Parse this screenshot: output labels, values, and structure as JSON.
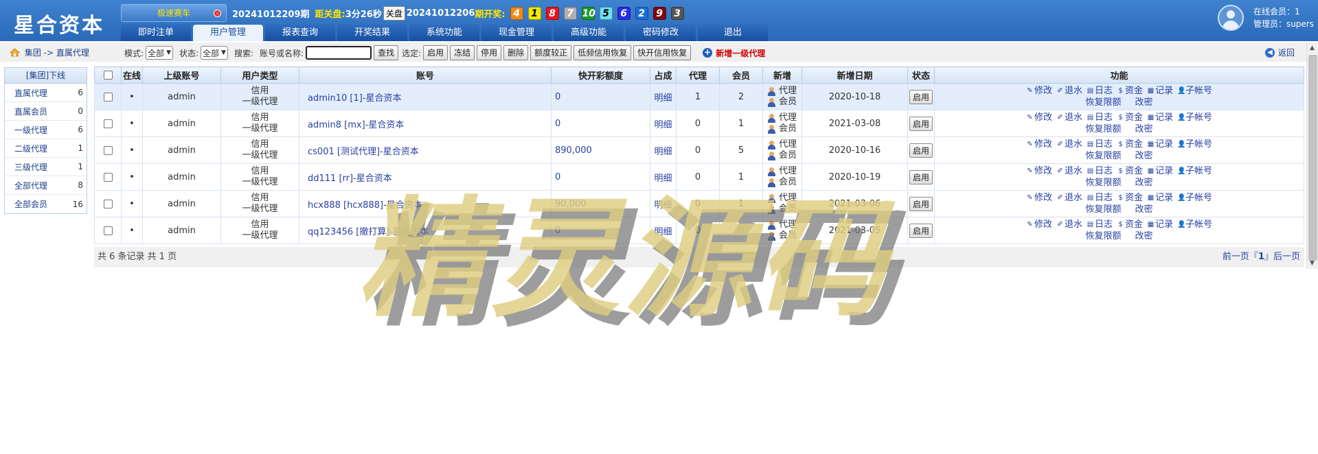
{
  "header": {
    "logo": "星合资本",
    "game_name": "极速赛车",
    "current_issue": "20241012209期",
    "close_label": "距关盘:",
    "countdown": "3分26秒",
    "close_button": "关盘",
    "last_issue": "20241012206",
    "last_draw_label": "期开奖:",
    "draw_balls": [
      {
        "n": "4",
        "bg": "#f08a16",
        "fg": "#ffffff"
      },
      {
        "n": "1",
        "bg": "#f2e700",
        "fg": "#000000"
      },
      {
        "n": "8",
        "bg": "#e8151b",
        "fg": "#ffffff"
      },
      {
        "n": "7",
        "bg": "#b0b0b0",
        "fg": "#ffffff"
      },
      {
        "n": "10",
        "bg": "#1a9a2c",
        "fg": "#ffffff"
      },
      {
        "n": "5",
        "bg": "#6ee0f0",
        "fg": "#000000"
      },
      {
        "n": "6",
        "bg": "#2a2ae8",
        "fg": "#ffffff"
      },
      {
        "n": "2",
        "bg": "#1a6ed8",
        "fg": "#ffffff"
      },
      {
        "n": "9",
        "bg": "#7a0c12",
        "fg": "#ffffff"
      },
      {
        "n": "3",
        "bg": "#555555",
        "fg": "#ffffff"
      }
    ],
    "nav": [
      "即时注单",
      "用户管理",
      "报表查询",
      "开奖结果",
      "系统功能",
      "现金管理",
      "高级功能",
      "密码修改",
      "退出"
    ],
    "active_nav": 1,
    "online_label": "在线会员：1",
    "admin_label": "管理员：supers"
  },
  "toolbar": {
    "crumb": "集团 -> 直属代理",
    "mode_label": "模式:",
    "mode_value": "全部",
    "status_label": "状态:",
    "status_value": "全部",
    "search_label": "搜索:",
    "search_hint": "账号或名称:",
    "search_value": "",
    "find_button": "查找",
    "selected_label": "选定:",
    "action_buttons": [
      "启用",
      "冻结",
      "停用",
      "删除",
      "额度较正",
      "低频信用恢复",
      "快开信用恢复"
    ],
    "add_agent": "新增一级代理",
    "back": "返回"
  },
  "sidebar": {
    "title": "[集团]下线",
    "items": [
      {
        "label": "直属代理",
        "count": "6"
      },
      {
        "label": "直属会员",
        "count": "0"
      },
      {
        "label": "一级代理",
        "count": "6"
      },
      {
        "label": "二级代理",
        "count": "1"
      },
      {
        "label": "三级代理",
        "count": "1"
      },
      {
        "label": "全部代理",
        "count": "8"
      },
      {
        "label": "全部会员",
        "count": "16"
      }
    ]
  },
  "table": {
    "headers": [
      "在线",
      "上级账号",
      "用户类型",
      "账号",
      "快开彩额度",
      "占成",
      "代理",
      "会员",
      "新增",
      "新增日期",
      "状态",
      "功能"
    ],
    "rows": [
      {
        "online": "•",
        "parent": "admin",
        "type1": "信用",
        "type2": "一级代理",
        "account": "admin10 [1]-星合资本",
        "credit": "0",
        "share": "明细",
        "agents": "1",
        "members": "2",
        "new_agent": "代理",
        "new_member": "会员",
        "date": "2020-10-18",
        "status": "启用"
      },
      {
        "online": "•",
        "parent": "admin",
        "type1": "信用",
        "type2": "一级代理",
        "account": "admin8 [mx]-星合资本",
        "credit": "0",
        "share": "明细",
        "agents": "0",
        "members": "1",
        "new_agent": "代理",
        "new_member": "会员",
        "date": "2021-03-08",
        "status": "启用"
      },
      {
        "online": "•",
        "parent": "admin",
        "type1": "信用",
        "type2": "一级代理",
        "account": "cs001 [测试代理]-星合资本",
        "credit": "890,000",
        "share": "明细",
        "agents": "0",
        "members": "5",
        "new_agent": "代理",
        "new_member": "会员",
        "date": "2020-10-16",
        "status": "启用"
      },
      {
        "online": "•",
        "parent": "admin",
        "type1": "信用",
        "type2": "一级代理",
        "account": "dd111 [rr]-星合资本",
        "credit": "0",
        "share": "明细",
        "agents": "0",
        "members": "1",
        "new_agent": "代理",
        "new_member": "会员",
        "date": "2020-10-19",
        "status": "启用"
      },
      {
        "online": "•",
        "parent": "admin",
        "type1": "信用",
        "type2": "一级代理",
        "account": "hcx888 [hcx888]-星合资本",
        "credit": "90,000",
        "share": "明细",
        "agents": "0",
        "members": "1",
        "new_agent": "代理",
        "new_member": "会员",
        "date": "2021-03-06",
        "status": "启用"
      },
      {
        "online": "•",
        "parent": "admin",
        "type1": "信用",
        "type2": "一级代理",
        "account": "qq123456 [撤打算]-星合资本",
        "credit": "0",
        "share": "明细",
        "agents": "0",
        "members": "0",
        "new_agent": "代理",
        "new_member": "会员",
        "date": "2021-03-05",
        "status": "启用"
      }
    ],
    "func_line1": [
      "修改",
      "退水",
      "日志",
      "资金",
      "记录",
      "子帐号"
    ],
    "func_line2": [
      "恢复限额",
      "改密"
    ],
    "footer_left": "共 6 条记录 共 1 页",
    "pager_prev": "前一页『",
    "pager_page": "1",
    "pager_next": "』后一页"
  },
  "watermark": "精灵源码"
}
